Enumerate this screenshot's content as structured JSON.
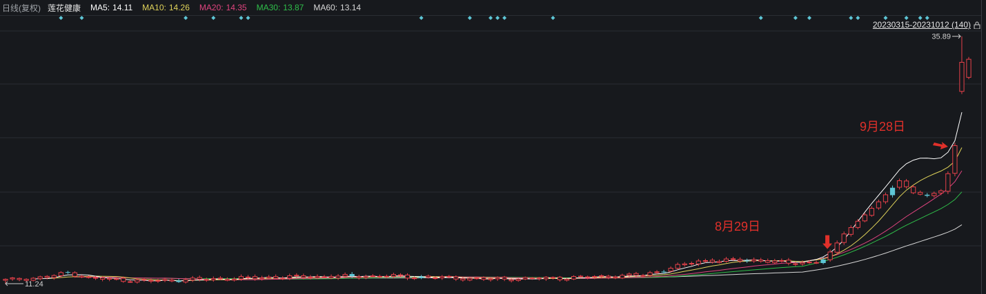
{
  "header": {
    "period_mode": "日线(复权)",
    "stock_name": "莲花健康",
    "ma": [
      {
        "label": "MA5:",
        "value": "14.11",
        "color": "#ffffff"
      },
      {
        "label": "MA10:",
        "value": "14.26",
        "color": "#e0d35a"
      },
      {
        "label": "MA20:",
        "value": "14.35",
        "color": "#e0447f"
      },
      {
        "label": "MA30:",
        "value": "13.87",
        "color": "#2fbf4a"
      },
      {
        "label": "MA60:",
        "value": "13.14",
        "color": "#d8d8d8"
      }
    ],
    "range": "20230315-20231012 (140)"
  },
  "chart_data": {
    "type": "candlestick",
    "range": "20230315-20231012",
    "bar_count": 140,
    "max_price_label": "35.89",
    "min_price_label": "11.24",
    "ylim": [
      10.9,
      36.9
    ],
    "annotations": [
      "8月29日",
      "9月28日"
    ],
    "colors": {
      "up": "#e8414a",
      "down": "#5ec6d6",
      "ma5": "#ffffff",
      "ma10": "#e0d35a",
      "ma20": "#e0447f",
      "ma30": "#2fbf4a",
      "ma60": "#d8d8d8",
      "marker": "#5ec6d6"
    },
    "anchors": [
      {
        "i": 0,
        "c": 11.6
      },
      {
        "i": 6,
        "c": 11.9
      },
      {
        "i": 9,
        "c": 12.35
      },
      {
        "i": 12,
        "c": 11.8
      },
      {
        "i": 20,
        "c": 11.5
      },
      {
        "i": 40,
        "c": 11.9
      },
      {
        "i": 55,
        "c": 12.0
      },
      {
        "i": 70,
        "c": 11.7
      },
      {
        "i": 80,
        "c": 11.8
      },
      {
        "i": 92,
        "c": 12.1
      },
      {
        "i": 100,
        "c": 13.5
      },
      {
        "i": 108,
        "c": 13.6
      },
      {
        "i": 113,
        "c": 13.3
      },
      {
        "i": 117,
        "c": 13.4
      },
      {
        "i": 118,
        "c": 13.65
      },
      {
        "i": 119,
        "c": 14.4
      },
      {
        "i": 121,
        "c": 16.2
      },
      {
        "i": 124,
        "c": 18.1
      },
      {
        "i": 126,
        "c": 19.4
      },
      {
        "i": 129,
        "c": 21.5
      },
      {
        "i": 131,
        "c": 20.3
      },
      {
        "i": 133,
        "c": 20.0
      },
      {
        "i": 135,
        "c": 20.5
      },
      {
        "i": 136,
        "c": 22.2
      },
      {
        "i": 137,
        "c": 25.0
      },
      {
        "i": 138,
        "c": 33.3
      },
      {
        "i": 139,
        "c": 31.8
      }
    ],
    "ma_end": {
      "ma5": 28.5,
      "ma10": 24.9,
      "ma20": 22.6,
      "ma30": 20.5,
      "ma60": 17.2
    },
    "marker_bars": [
      8,
      11,
      26,
      30,
      34,
      35,
      60,
      67,
      70,
      71,
      72,
      79,
      109,
      114,
      116,
      122,
      123,
      127,
      130,
      132,
      133
    ]
  }
}
